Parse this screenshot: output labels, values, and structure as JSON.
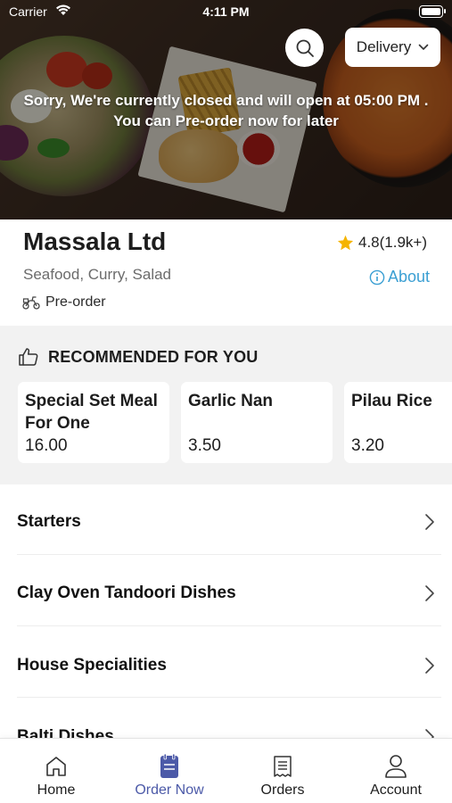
{
  "status_bar": {
    "carrier": "Carrier",
    "time": "4:11 PM"
  },
  "header": {
    "closed_message_line1": "Sorry, We're currently closed and will open at 05:00 PM .",
    "closed_message_line2": "You can Pre-order now for later",
    "order_mode": "Delivery",
    "search_icon": "search-icon"
  },
  "restaurant": {
    "name": "Massala Ltd",
    "rating": "4.8(1.9k+)",
    "cuisines": "Seafood, Curry, Salad",
    "about_label": "About",
    "preorder_label": "Pre-order"
  },
  "recommended": {
    "title": "RECOMMENDED FOR YOU",
    "items": [
      {
        "name": "Special Set Meal For One",
        "price": "16.00"
      },
      {
        "name": "Garlic Nan",
        "price": "3.50"
      },
      {
        "name": "Pilau Rice",
        "price": "3.20"
      }
    ]
  },
  "categories": [
    {
      "label": "Starters"
    },
    {
      "label": "Clay Oven Tandoori Dishes"
    },
    {
      "label": "House Specialities"
    },
    {
      "label": "Balti Dishes"
    }
  ],
  "tabbar": {
    "items": [
      {
        "label": "Home",
        "icon": "home-icon"
      },
      {
        "label": "Order Now",
        "icon": "order-icon",
        "active": true
      },
      {
        "label": "Orders",
        "icon": "receipt-icon"
      },
      {
        "label": "Account",
        "icon": "user-icon"
      }
    ]
  },
  "colors": {
    "accent": "#4c5aa8",
    "link": "#3b9fd3",
    "star": "#f5b400",
    "section_bg": "#f2f2f2"
  }
}
